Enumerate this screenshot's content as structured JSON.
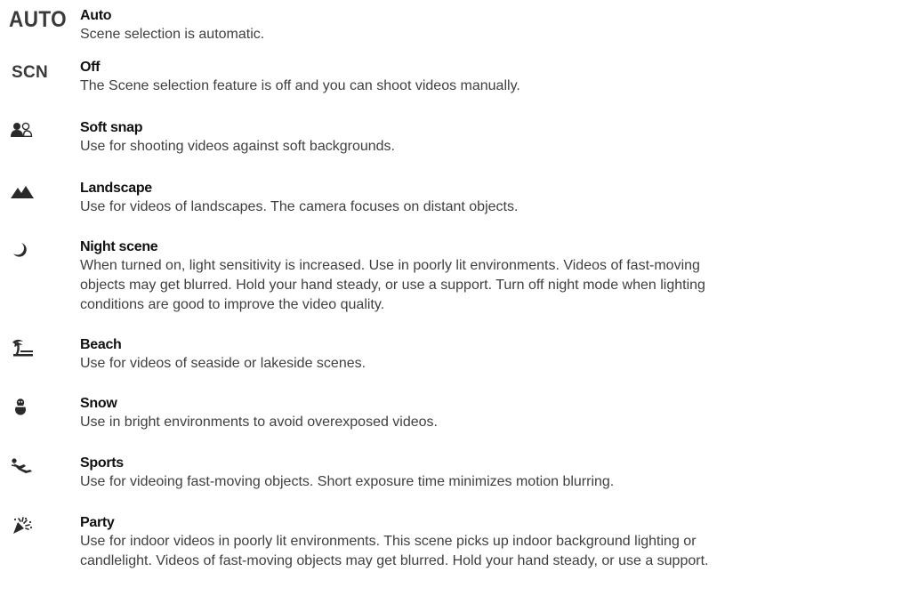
{
  "scenes": [
    {
      "icon": "auto-text-icon",
      "icon_text": "AUTO",
      "title": "Auto",
      "lines": [
        "Scene selection is automatic."
      ]
    },
    {
      "icon": "scn-text-icon",
      "icon_text": "SCN",
      "title": "Off",
      "lines": [
        "The Scene selection feature is off and you can shoot videos manually."
      ]
    },
    {
      "icon": "soft-snap-icon",
      "title": "Soft snap",
      "lines": [
        "Use for shooting videos against soft backgrounds."
      ]
    },
    {
      "icon": "landscape-icon",
      "title": "Landscape",
      "lines": [
        "Use for videos of landscapes. The camera focuses on distant objects."
      ]
    },
    {
      "icon": "night-scene-icon",
      "title": "Night scene",
      "lines": [
        "When turned on, light sensitivity is increased. Use in poorly lit environments. Videos of fast-moving",
        "objects may get blurred. Hold your hand steady, or use a support. Turn off night mode when lighting",
        "conditions are good to improve the video quality."
      ]
    },
    {
      "icon": "beach-icon",
      "title": "Beach",
      "lines": [
        "Use for videos of seaside or lakeside scenes."
      ]
    },
    {
      "icon": "snow-icon",
      "title": "Snow",
      "lines": [
        "Use in bright environments to avoid overexposed videos."
      ]
    },
    {
      "icon": "sports-icon",
      "title": "Sports",
      "lines": [
        "Use for videoing fast-moving objects. Short exposure time minimizes motion blurring."
      ]
    },
    {
      "icon": "party-icon",
      "title": "Party",
      "lines": [
        "Use for indoor videos in poorly lit environments. This scene picks up indoor background lighting or",
        "candlelight. Videos of fast-moving objects may get blurred. Hold your hand steady, or use a support."
      ]
    }
  ]
}
